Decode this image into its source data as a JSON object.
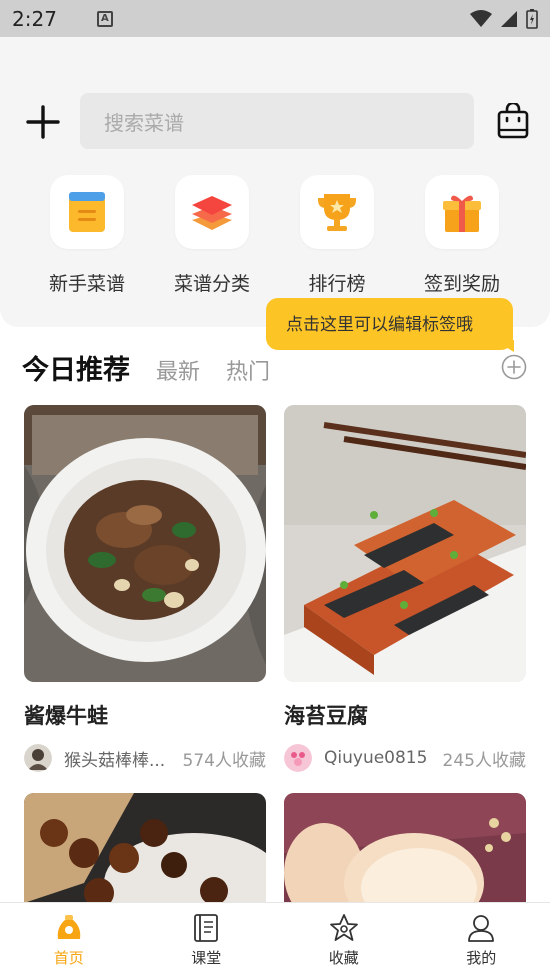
{
  "status_bar": {
    "time": "2:27",
    "notification_badge": "A"
  },
  "search": {
    "placeholder": "搜索菜谱"
  },
  "quick_actions": [
    {
      "label": "新手菜谱",
      "icon": "clipboard-icon"
    },
    {
      "label": "菜谱分类",
      "icon": "layers-icon"
    },
    {
      "label": "排行榜",
      "icon": "trophy-icon"
    },
    {
      "label": "签到奖励",
      "icon": "gift-icon"
    }
  ],
  "tooltip": {
    "text": "点击这里可以编辑标签哦"
  },
  "tabs": [
    {
      "label": "今日推荐",
      "active": true
    },
    {
      "label": "最新",
      "active": false
    },
    {
      "label": "热门",
      "active": false
    }
  ],
  "recipes": [
    {
      "title": "酱爆牛蛙",
      "author": "猴头菇棒棒...",
      "favorites": "574人收藏"
    },
    {
      "title": "海苔豆腐",
      "author": "Qiuyue0815",
      "favorites": "245人收藏"
    },
    {
      "title": "",
      "author": "",
      "favorites": ""
    },
    {
      "title": "",
      "author": "",
      "favorites": ""
    }
  ],
  "bottom_nav": [
    {
      "label": "首页",
      "icon": "home-chef-icon",
      "active": true
    },
    {
      "label": "课堂",
      "icon": "book-icon",
      "active": false
    },
    {
      "label": "收藏",
      "icon": "star-icon",
      "active": false
    },
    {
      "label": "我的",
      "icon": "user-icon",
      "active": false
    }
  ],
  "colors": {
    "accent": "#f7a513",
    "tooltip_bg": "#fdc426",
    "panel_bg": "#f5f5f5"
  }
}
